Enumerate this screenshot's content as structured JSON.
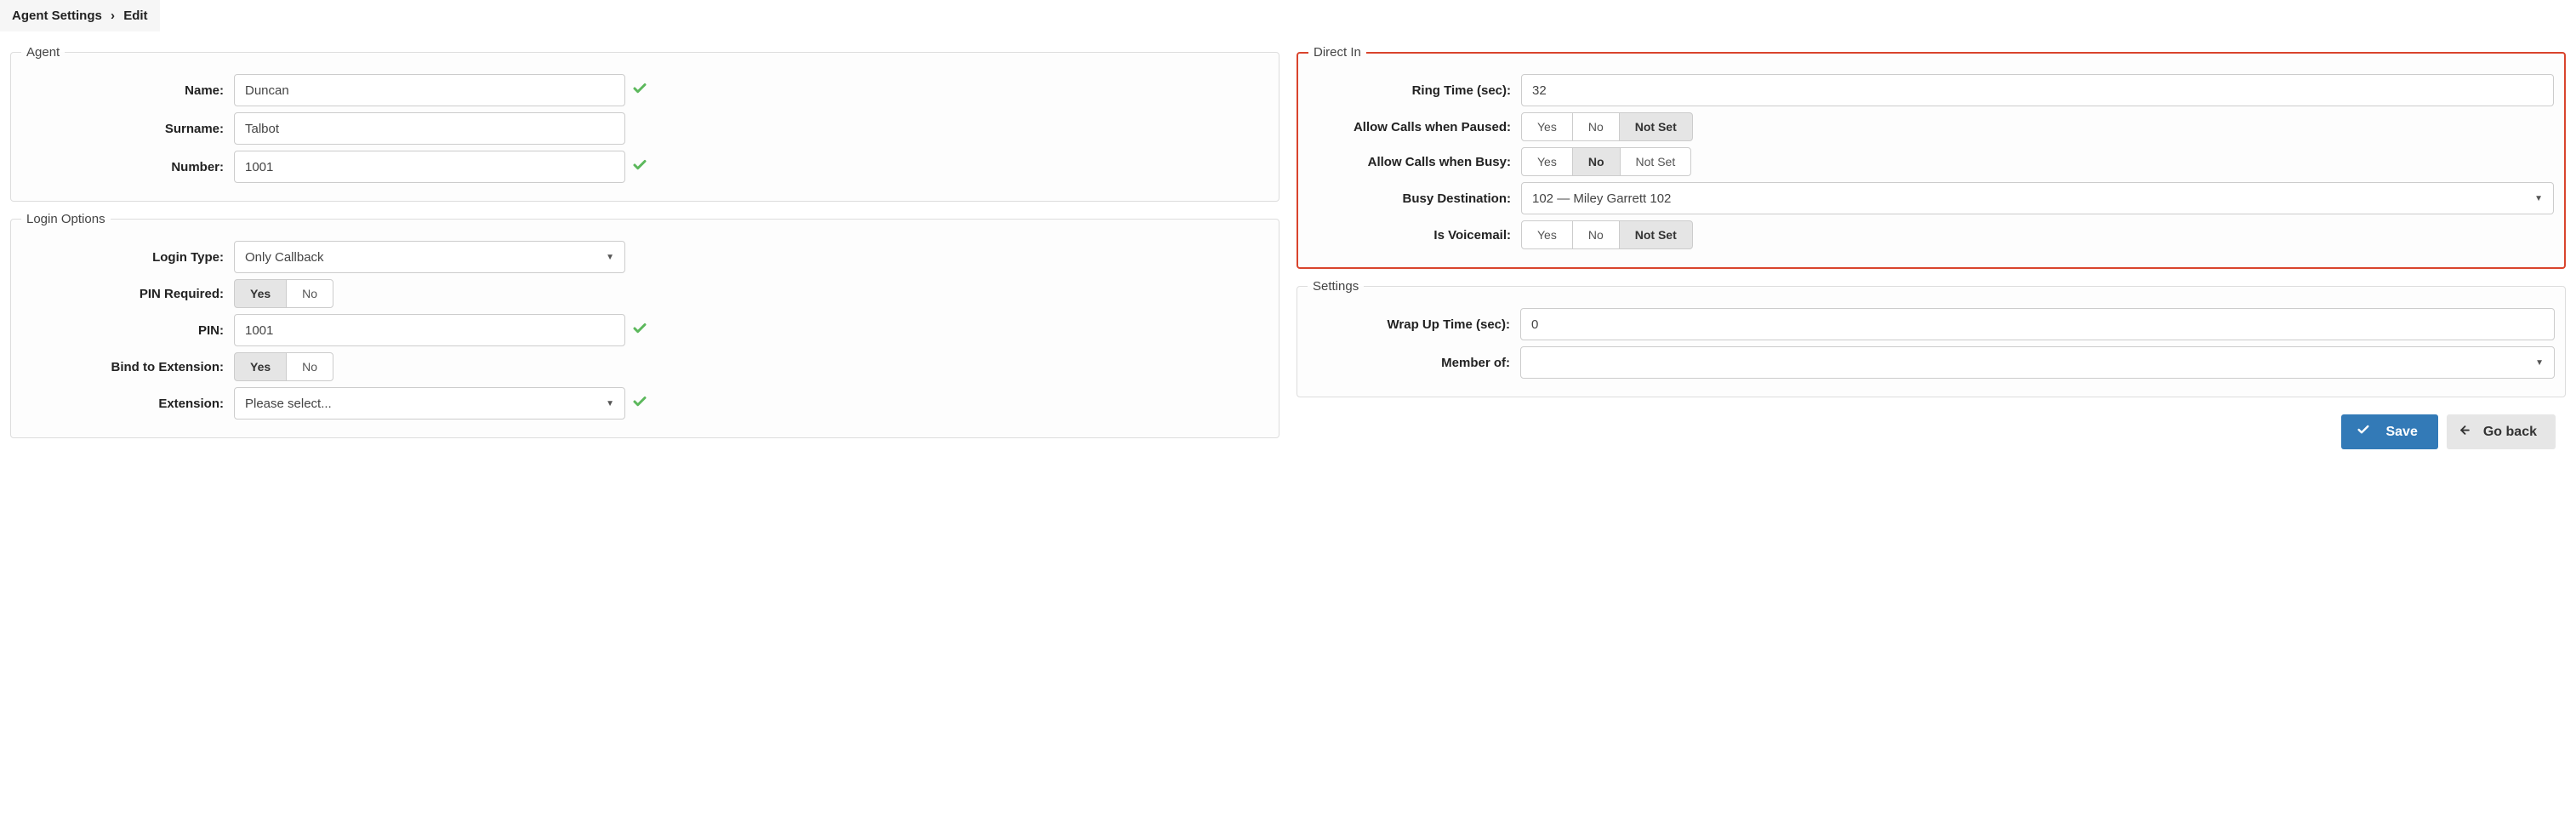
{
  "breadcrumb": {
    "parent": "Agent Settings",
    "current": "Edit"
  },
  "agent": {
    "legend": "Agent",
    "name_label": "Name:",
    "name_value": "Duncan",
    "surname_label": "Surname:",
    "surname_value": "Talbot",
    "number_label": "Number:",
    "number_value": "1001"
  },
  "login": {
    "legend": "Login Options",
    "type_label": "Login Type:",
    "type_value": "Only Callback",
    "pin_required_label": "PIN Required:",
    "pin_required_yes": "Yes",
    "pin_required_no": "No",
    "pin_required_selected": "Yes",
    "pin_label": "PIN:",
    "pin_value": "1001",
    "bind_ext_label": "Bind to Extension:",
    "bind_ext_yes": "Yes",
    "bind_ext_no": "No",
    "bind_ext_selected": "Yes",
    "extension_label": "Extension:",
    "extension_value": "Please select..."
  },
  "direct_in": {
    "legend": "Direct In",
    "ring_time_label": "Ring Time (sec):",
    "ring_time_value": "32",
    "allow_paused_label": "Allow Calls when Paused:",
    "allow_paused_yes": "Yes",
    "allow_paused_no": "No",
    "allow_paused_notset": "Not Set",
    "allow_paused_selected": "Not Set",
    "allow_busy_label": "Allow Calls when Busy:",
    "allow_busy_yes": "Yes",
    "allow_busy_no": "No",
    "allow_busy_notset": "Not Set",
    "allow_busy_selected": "No",
    "busy_dest_label": "Busy Destination:",
    "busy_dest_value": "102  —  Miley Garrett 102",
    "is_voicemail_label": "Is Voicemail:",
    "is_voicemail_yes": "Yes",
    "is_voicemail_no": "No",
    "is_voicemail_notset": "Not Set",
    "is_voicemail_selected": "Not Set"
  },
  "settings": {
    "legend": "Settings",
    "wrapup_label": "Wrap Up Time (sec):",
    "wrapup_value": "0",
    "member_of_label": "Member of:",
    "member_of_value": ""
  },
  "footer": {
    "save": "Save",
    "goback": "Go back"
  }
}
